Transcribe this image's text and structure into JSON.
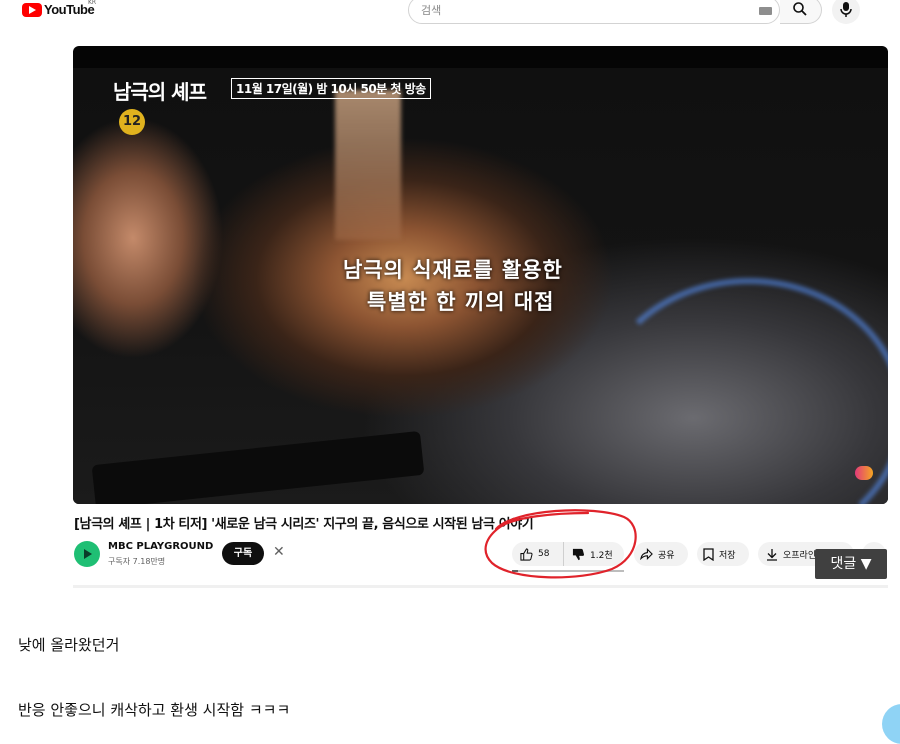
{
  "header": {
    "logo_text": "YouTube",
    "logo_region": "KR",
    "search_placeholder": "검색"
  },
  "player": {
    "show_title": "남극의 셰프",
    "airdate": "11월 17일(월) 밤 10시 50분 첫 방송",
    "age_rating": "12",
    "caption_line1": "남극의 식재료를 활용한",
    "caption_line2": "특별한 한 끼의 대접"
  },
  "video": {
    "title": "[남극의 셰프 | 1차 티저] '새로운 남극 시리즈' 지구의 끝, 음식으로 시작된 남극 이야기",
    "channel_name": "MBC PLAYGROUND",
    "subscribers": "구독자 7.18만명",
    "subscribe_label": "구독",
    "dismiss_label": "✕",
    "like_count": "58",
    "dislike_count": "1.2천",
    "like_ratio": 0.05,
    "share_label": "공유",
    "save_label": "저장",
    "offline_label": "오프라인 저장",
    "more_label": "···"
  },
  "overlay": {
    "comments_button": "댓글 ▼"
  },
  "post": {
    "line1": "낮에 올라왔던거",
    "line2": "반응 안좋으니 캐삭하고 환생 시작함 ㅋㅋㅋ"
  },
  "colors": {
    "brand_red": "#ff0000",
    "annotation_red": "#e0232b",
    "subscribe_bg": "#0f0f0f"
  }
}
